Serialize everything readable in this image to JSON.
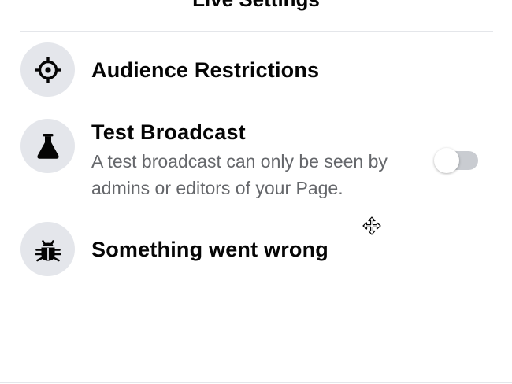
{
  "header": {
    "title": "Live Settings"
  },
  "settings": [
    {
      "title": "Audience Restrictions",
      "icon": "crosshair-icon"
    },
    {
      "title": "Test Broadcast",
      "description": "A test broadcast can only be seen by admins or editors of your Page.",
      "icon": "flask-icon",
      "toggle_on": false
    },
    {
      "title": "Something went wrong",
      "icon": "bug-icon"
    }
  ],
  "colors": {
    "icon_bg": "#e4e6eb",
    "title_text": "#050505",
    "secondary_text": "#65676b",
    "toggle_track": "#c9ccd1"
  }
}
